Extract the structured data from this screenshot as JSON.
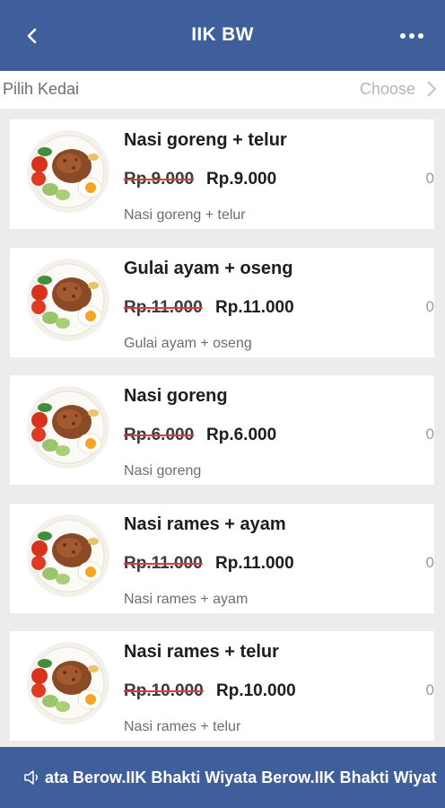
{
  "appbar": {
    "title": "IIK BW",
    "icons": {
      "back": "chevron-left-icon",
      "more": "more-horizontal-icon"
    }
  },
  "shop_selector": {
    "label": "Pilih Kedai",
    "value": "Choose",
    "icon": "chevron-right-icon"
  },
  "menu_items": [
    {
      "name": "Nasi goreng + telur",
      "original_price": "Rp.9.000",
      "price": "Rp.9.000",
      "description": "Nasi goreng + telur",
      "qty": "0"
    },
    {
      "name": "Gulai ayam + oseng",
      "original_price": "Rp.11.000",
      "price": "Rp.11.000",
      "description": "Gulai ayam + oseng",
      "qty": "0"
    },
    {
      "name": "Nasi goreng",
      "original_price": "Rp.6.000",
      "price": "Rp.6.000",
      "description": "Nasi goreng",
      "qty": "0"
    },
    {
      "name": "Nasi rames + ayam",
      "original_price": "Rp.11.000",
      "price": "Rp.11.000",
      "description": "Nasi rames + ayam",
      "qty": "0"
    },
    {
      "name": "Nasi rames + telur",
      "original_price": "Rp.10.000",
      "price": "Rp.10.000",
      "description": "Nasi rames + telur",
      "qty": "0"
    }
  ],
  "announcement": {
    "icon": "speaker-icon",
    "text": "ata Berow.IIK Bhakti Wiyata Berow.IIK Bhakti Wiyat"
  },
  "colors": {
    "primary": "#3e5e9c",
    "strikethrough": "#e23a3a",
    "background": "#ececec"
  }
}
